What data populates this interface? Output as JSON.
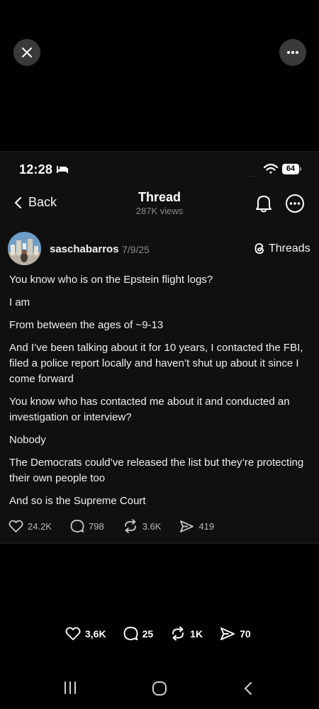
{
  "viewer": {
    "close_icon": "close-icon",
    "more_icon": "more-horizontal-icon"
  },
  "status_bar": {
    "time": "12:28",
    "signal_text": "....",
    "battery": "64"
  },
  "header": {
    "back_label": "Back",
    "title": "Thread",
    "views": "287K views"
  },
  "post": {
    "username": "saschabarros",
    "date": "7/9/25",
    "source_label": "Threads",
    "paragraphs": [
      "You know who is on the Epstein flight logs?",
      "I am",
      "From between the ages of ~9-13",
      "And I’ve been talking about it for 10 years, I contacted the FBI, filed a police report locally and haven’t shut up about it since I come forward",
      "You know who has contacted me about it and conducted an investigation or interview?",
      "Nobody",
      "The Democrats could’ve released the list but they’re protecting their own people too",
      "And so is the Supreme Court"
    ],
    "stats": {
      "likes": "24.2K",
      "replies": "798",
      "reposts": "3.6K",
      "shares": "419"
    }
  },
  "reactions": {
    "likes": "3,6K",
    "comments": "25",
    "reposts": "1K",
    "shares": "70"
  },
  "colors": {
    "background": "#000000",
    "card": "#101010",
    "muted_text": "#8a8a8a"
  }
}
